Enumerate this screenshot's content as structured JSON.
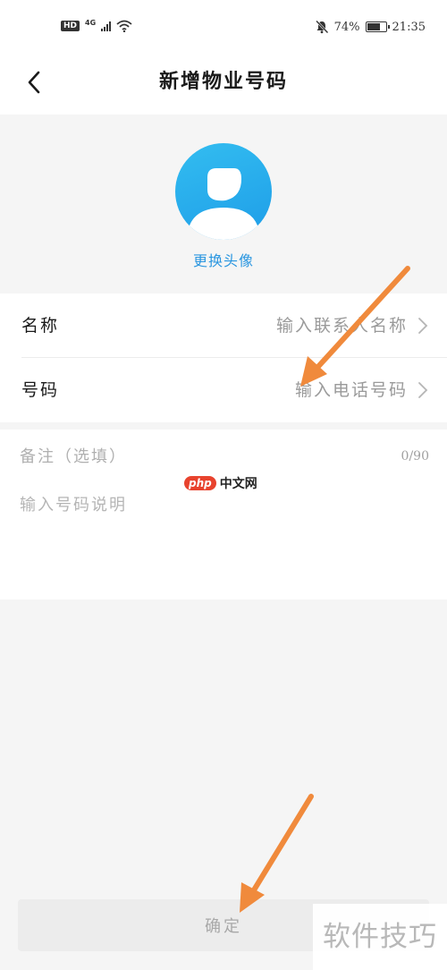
{
  "status_bar": {
    "hd": "HD",
    "network": "4G",
    "battery_percent_text": "74%",
    "battery_level": 0.74,
    "time": "21:35"
  },
  "nav": {
    "title": "新增物业号码"
  },
  "avatar": {
    "change_label": "更换头像"
  },
  "form": {
    "name": {
      "label": "名称",
      "placeholder": "输入联系人名称"
    },
    "phone": {
      "label": "号码",
      "placeholder": "输入电话号码"
    }
  },
  "remark": {
    "title": "备注（选填）",
    "count": "0/90",
    "placeholder": "输入号码说明"
  },
  "confirm_label": "确定",
  "watermarks": {
    "php_badge": "php",
    "php_site": "中文网",
    "corner": "软件技巧"
  },
  "colors": {
    "accent_blue": "#2a96e0",
    "arrow_orange": "#f08a3c"
  }
}
